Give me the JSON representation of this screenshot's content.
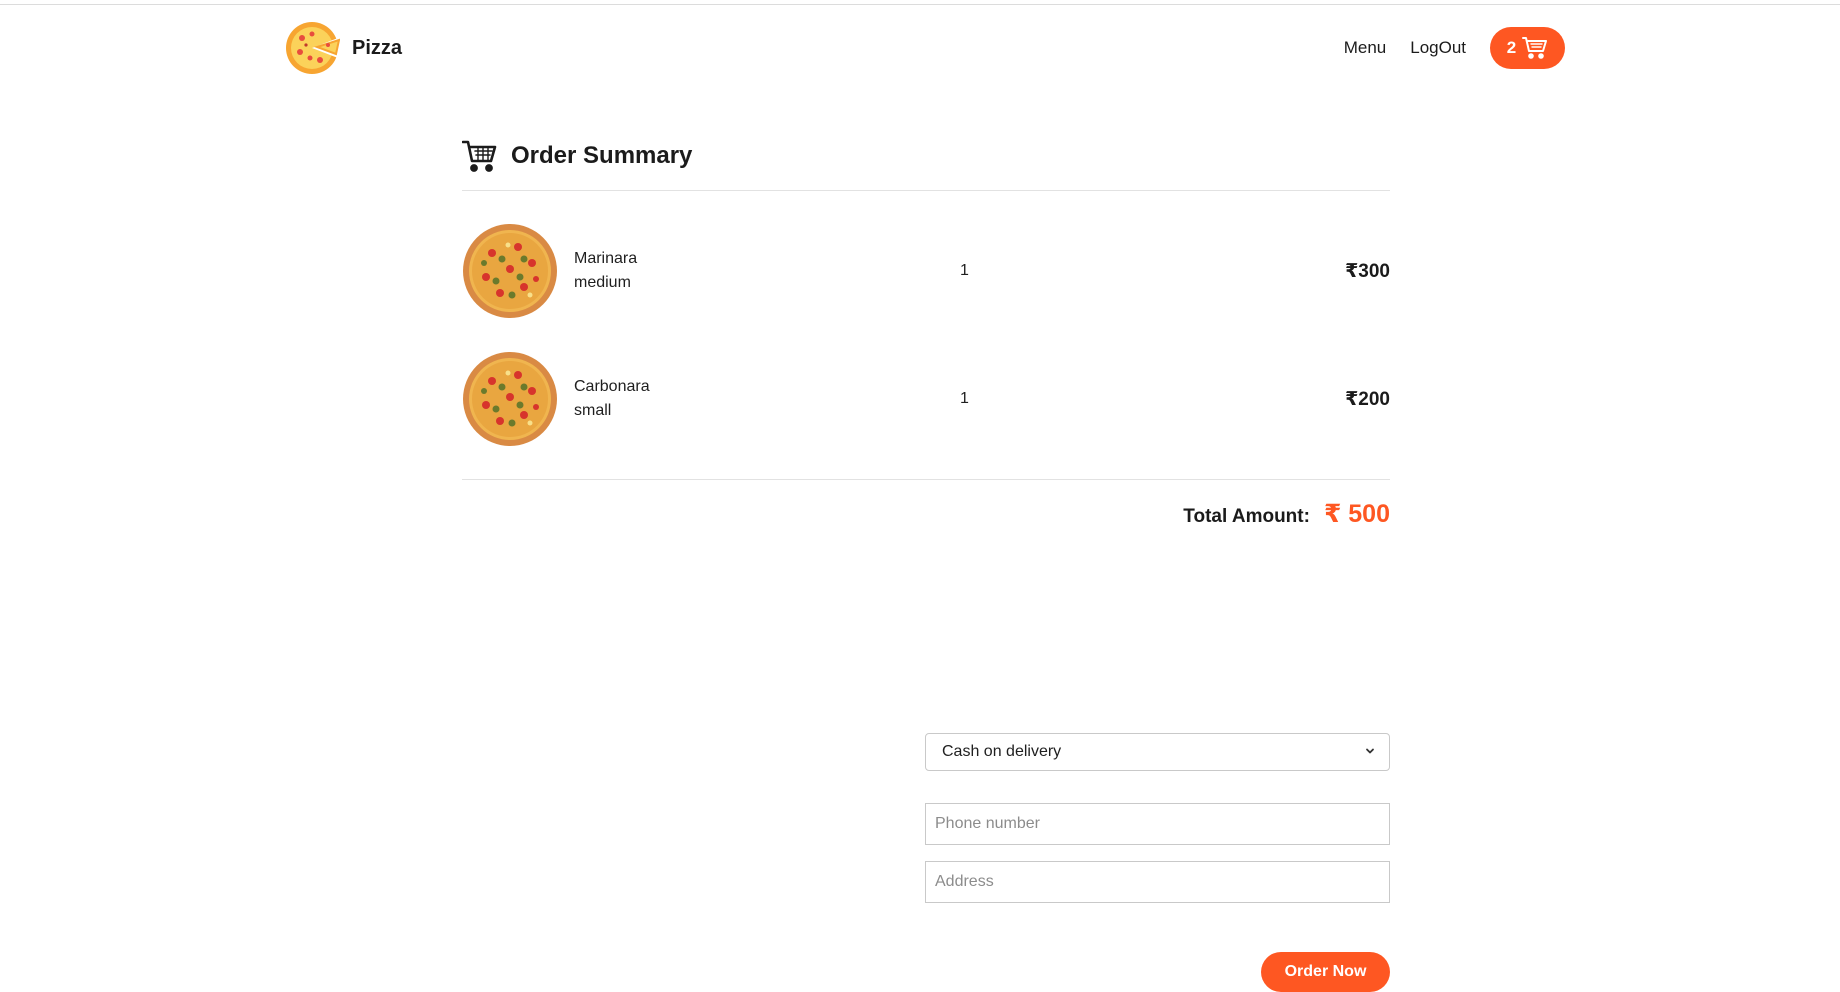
{
  "brand": {
    "name": "Pizza",
    "logo_icon": "pizza-logo-icon"
  },
  "nav": {
    "links": [
      "Menu",
      "LogOut"
    ],
    "cart": {
      "count": "2",
      "icon": "cart-icon"
    }
  },
  "summary": {
    "title": "Order Summary",
    "icon": "cart-icon",
    "items": [
      {
        "name": "Marinara",
        "size": "medium",
        "qty": "1",
        "price": "₹300"
      },
      {
        "name": "Carbonara",
        "size": "small",
        "qty": "1",
        "price": "₹200"
      }
    ],
    "total_label": "Total Amount:",
    "total_value": "₹ 500"
  },
  "form": {
    "payment_selected": "Cash on delivery",
    "phone_placeholder": "Phone number",
    "address_placeholder": "Address",
    "submit_label": "Order Now"
  },
  "colors": {
    "accent": "#fe5722",
    "text": "#1b1b1b"
  }
}
